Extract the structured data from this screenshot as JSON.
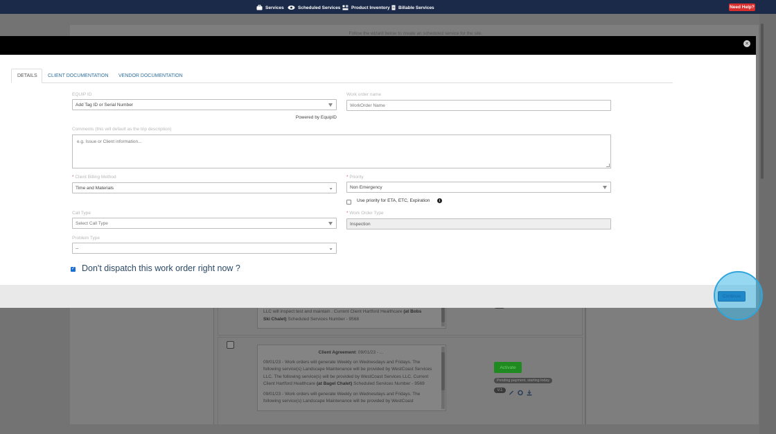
{
  "nav": {
    "items": [
      {
        "label": "Services",
        "icon": "briefcase-icon"
      },
      {
        "label": "Scheduled Services",
        "icon": "eye-icon"
      },
      {
        "label": "Product Inventory",
        "icon": "inventory-icon"
      },
      {
        "label": "Billable Services",
        "icon": "document-icon"
      }
    ],
    "help_label": "Need Help?"
  },
  "background": {
    "wizard_text": "Follow the wizard below to create an scheduled service for the site.",
    "row1": {
      "line1": "LLC will inspect test and maintain . Current Client Hartford Healthcare",
      "bold1": "(at Bobs",
      "line2_bold": "Ski Chalet)",
      "line2": "Scheduled Services Number - 9568"
    },
    "row2": {
      "title_bold": "Client Agreement",
      "title_rest": ": 09/01/23 - ...",
      "para1": "09/01/23 - Work orders will generate Weekly on Wednesdays and Fridays. The following service(s) Landscape Maintenance will be provided by WestCoast Services LLC. The following service(s) will be provided by WestCoast Services LLC. Current Client Hartford Healthcare",
      "para1_bold": "(at Bagel Chalet)",
      "para1_tail": "Scheduled Services Number - 9569",
      "para2": "09/01/23 - Work orders will generate Weekly on Wednesdays and Fridays. The following service(s) Landscape Maintenance will be provided by WestCoast"
    },
    "activate_label": "Activate",
    "pending_label": "Pending payment, starting today",
    "version_label": "V.1"
  },
  "modal": {
    "tabs": [
      {
        "label": "DETAILS",
        "active": true
      },
      {
        "label": "CLIENT DOCUMENTATION",
        "active": false
      },
      {
        "label": "VENDOR DOCUMENTATION",
        "active": false
      }
    ],
    "equip_id": {
      "label": "EQUIP ID",
      "value": "Add Tag ID or Serial Number"
    },
    "powered_by": "Powered by EquipID",
    "work_order_name": {
      "label": "Work order name",
      "placeholder": "WorkOrder Name"
    },
    "comments": {
      "label": "Comments (this will default as the trip description)",
      "placeholder": "e.g. Issue or Client information..."
    },
    "billing_method": {
      "label": "Client Billing Method",
      "value": "Time and Materials"
    },
    "priority": {
      "label": "Priority",
      "value": "Non Emergency"
    },
    "priority_checkbox_label": "Use priority for ETA, ETC, Expiration",
    "call_type": {
      "label": "Call Type",
      "value": "Select Call Type"
    },
    "work_order_type": {
      "label": "Work Order Type",
      "value": "Inspection"
    },
    "problem_type": {
      "label": "Problem Type",
      "value": "--"
    },
    "dispatch_label": "Don't dispatch this work order right now ?",
    "continue_label": "Continue"
  },
  "colors": {
    "nav_bg": "#1b2a49",
    "help_red": "#d82e2e",
    "link_blue": "#2f6f9f",
    "highlight": "#40b6e6"
  }
}
